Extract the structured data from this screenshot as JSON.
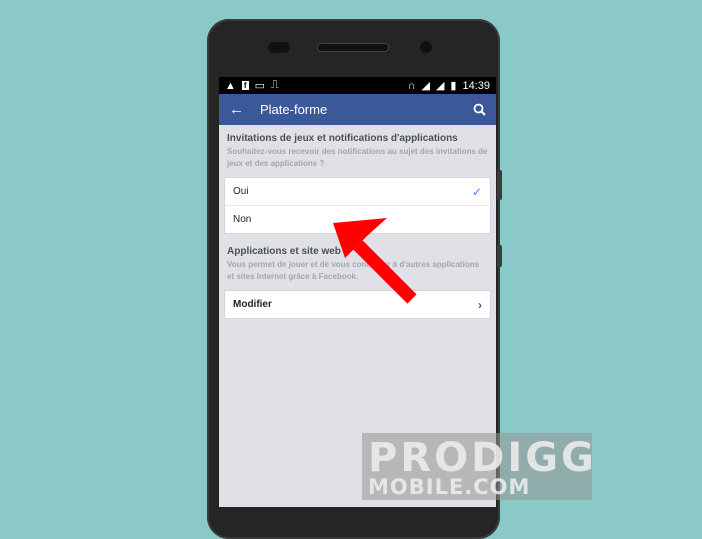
{
  "statusbar": {
    "left_icons": [
      "download-icon",
      "facebook-icon",
      "image-icon",
      "usb-icon"
    ],
    "right_icons": [
      "headphones-icon",
      "signal-icon",
      "signal-icon",
      "battery-icon"
    ],
    "time": "14:39"
  },
  "appbar": {
    "back_icon": "←",
    "title": "Plate-forme",
    "search_icon": "search-icon"
  },
  "sections": [
    {
      "title": "Invitations de jeux et notifications d'applications",
      "subtitle": "Souhaitez-vous recevoir des notifications au sujet des invitations de jeux et des applications ?",
      "options": [
        {
          "label": "Oui",
          "selected": true
        },
        {
          "label": "Non",
          "selected": false
        }
      ]
    },
    {
      "title": "Applications et site web",
      "subtitle": "Vous permet de jouer et de vous connecter à d'autres applications et sites Internet grâce à Facebook.",
      "action_label": "Modifier"
    }
  ],
  "check_glyph": "✓",
  "chevron_glyph": "›",
  "watermark": {
    "line1": "PRODIGG",
    "line2": "MOBILE.COM"
  },
  "colors": {
    "appbar": "#3b5998",
    "check": "#4080ff",
    "arrow": "#ff0000",
    "background": "#8ac9c8"
  }
}
